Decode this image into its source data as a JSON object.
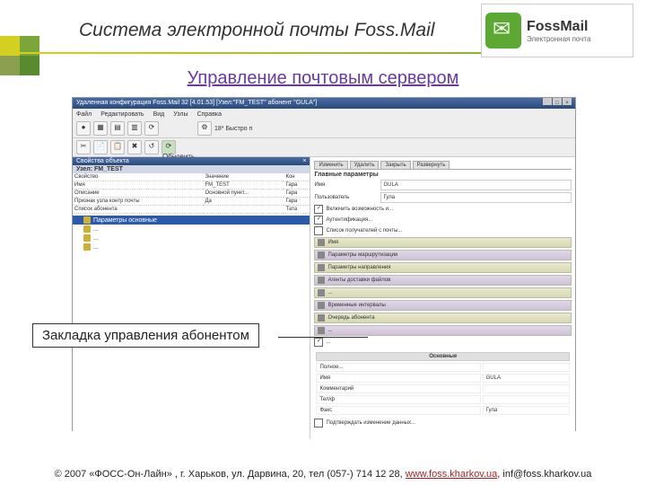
{
  "header": {
    "title": "Система электронной почты Foss.Mail",
    "logo_text": "FossMail",
    "logo_sub": "Электронная почта"
  },
  "subtitle": "Управление почтовым сервером",
  "callout": "Закладка управления абонентом",
  "screenshot": {
    "window_title": "Удаленная конфигурация Foss.Mail 32 [4.01.53]   [Узел:\"FM_TEST\"  абонент \"GULA\"]",
    "menu": [
      "Файл",
      "Редактировать",
      "Вид",
      "Узлы",
      "Справка"
    ],
    "toolbar2_label": "18* Быстро п",
    "left_panel_title": "Свойства объекта",
    "node_label": "Узел: FM_TEST",
    "prop_headers": [
      "Свойство",
      "Значение",
      "Кон"
    ],
    "props": [
      {
        "k": "Имя",
        "v": "FM_TEST",
        "c": "Гара"
      },
      {
        "k": "Описание",
        "v": "Основной пункт...",
        "c": "Гара"
      },
      {
        "k": "Признак узла контр почты",
        "v": "Да",
        "c": "Гара"
      },
      {
        "k": "Список абонента",
        "v": "",
        "c": "Тата"
      }
    ],
    "tree": [
      {
        "label": "Параметры основные",
        "sel": true
      },
      {
        "label": "...",
        "sel": false
      },
      {
        "label": "...",
        "sel": false
      },
      {
        "label": "...",
        "sel": false
      }
    ],
    "right_tabs": [
      "Изменить",
      "Удалить",
      "Закрыть",
      "Развернуть"
    ],
    "main_group": "Главные параметры",
    "fields": {
      "abonent_label": "Имя",
      "abonent_val": "GULA",
      "polz_label": "Пользователь",
      "polz_val": "Гула"
    },
    "checks": [
      {
        "c": true,
        "t": "Включить возможность и..."
      },
      {
        "c": true,
        "t": "Аутентификация..."
      },
      {
        "c": false,
        "t": "Список получателей с почты..."
      }
    ],
    "sections": [
      "Имя",
      "Параметры маршрутизации",
      "Параметры направления",
      "Агенты доставки файлов",
      "...",
      "Временные интервалы",
      "Очередь абонента",
      "..."
    ],
    "bottom_grid_title": "Основные",
    "bottom_grid": [
      {
        "k": "Полное...",
        "v": ""
      },
      {
        "k": "Имя",
        "v": "GULA"
      },
      {
        "k": "Комментарий",
        "v": ""
      },
      {
        "k": "Тел/ф",
        "v": ""
      },
      {
        "k": "Факс",
        "v": "Гула"
      }
    ],
    "status_check": "Подтверждать изменение данных..."
  },
  "footer": {
    "copyright": "© 2007 «ФОСС-Он-Лайн» , г. Харьков, ул. Дарвина, 20, тел (057-) 714 12 28, ",
    "link": "www.foss.kharkov.ua",
    "email": ", inf@foss.kharkov.ua"
  }
}
